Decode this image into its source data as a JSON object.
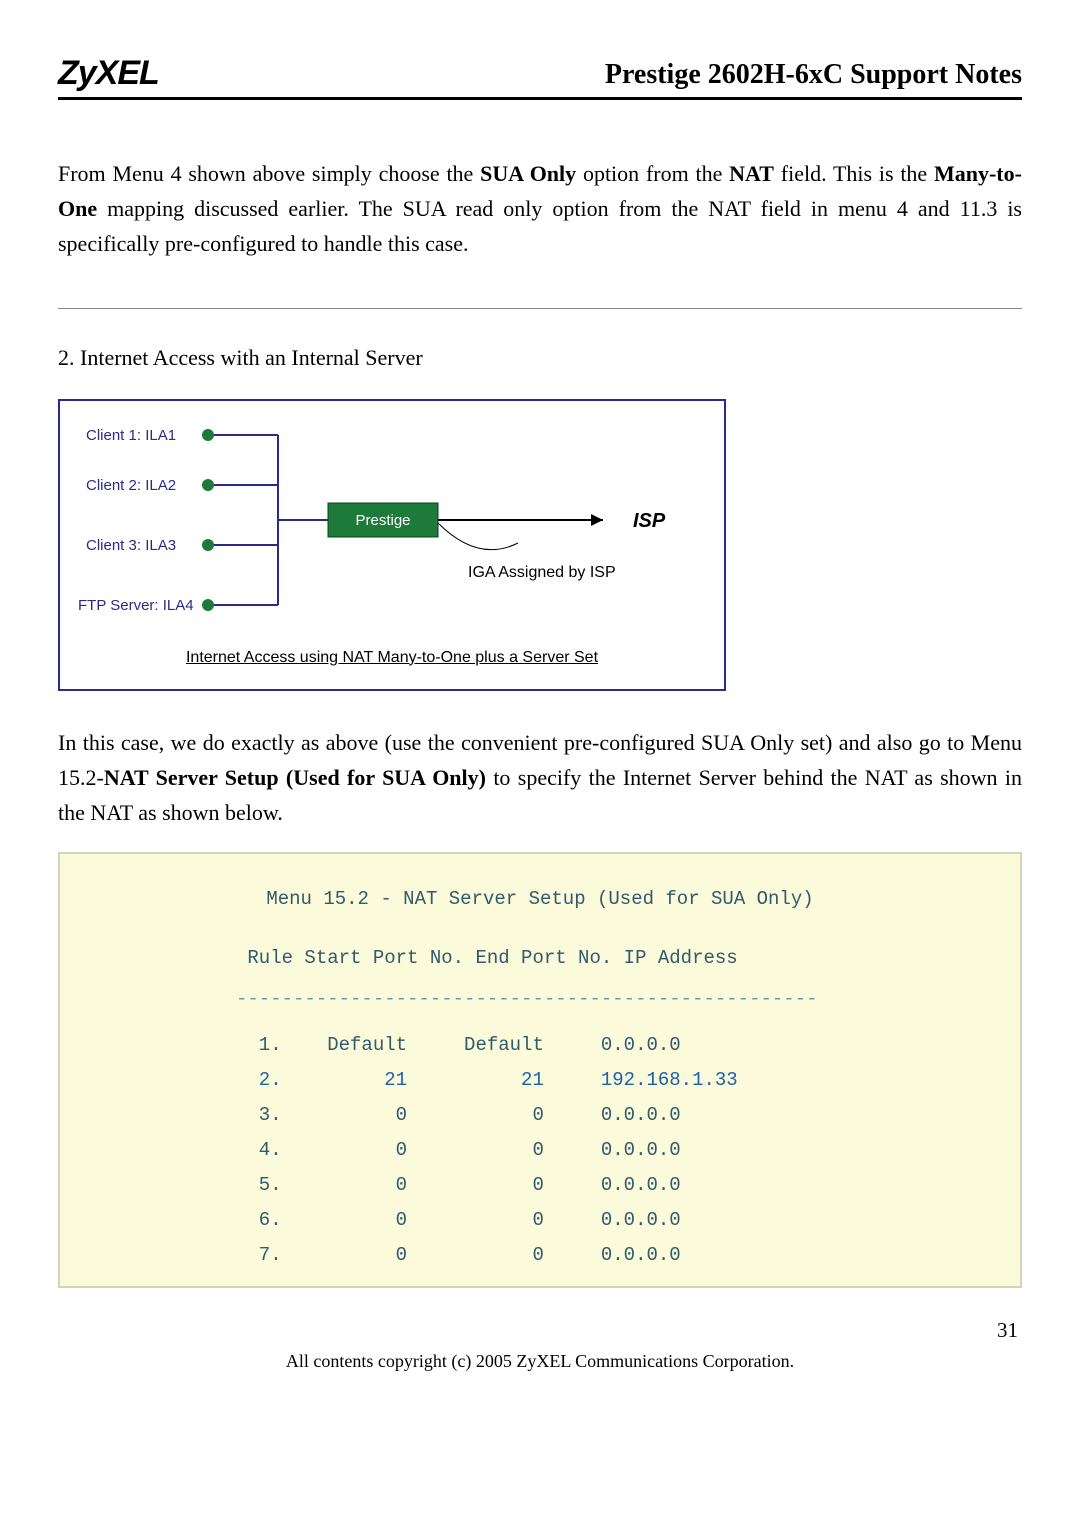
{
  "header": {
    "logo": "ZyXEL",
    "title": "Prestige 2602H-6xC Support Notes"
  },
  "para1_pre": "From Menu 4 shown above simply choose the ",
  "para1_b1": "SUA Only",
  "para1_mid1": " option from the ",
  "para1_b2": "NAT",
  "para1_mid2": " field. This is the ",
  "para1_b3": "Many-to-One",
  "para1_post": " mapping discussed earlier. The SUA read only option from the NAT field in menu 4 and 11.3 is specifically pre-configured to handle this case.",
  "section2_title": "2. Internet Access with an Internal Server",
  "diagram": {
    "client1": "Client 1: ILA1",
    "client2": "Client 2: ILA2",
    "client3": "Client 3: ILA3",
    "ftp": "FTP Server: ILA4",
    "router": "Prestige",
    "isp": "ISP",
    "iga": "IGA Assigned by ISP",
    "caption": "Internet Access using NAT Many-to-One plus a Server Set"
  },
  "para2_pre": "In this case, we do exactly as above (use the convenient pre-configured SUA Only set) and also go to Menu 15.2-",
  "para2_b1": "NAT Server Setup (Used for SUA Only)",
  "para2_post": " to specify the Internet Server behind the NAT as shown in the NAT as shown below.",
  "terminal": {
    "title": "Menu 15.2 - NAT Server Setup (Used for SUA Only)",
    "columns": " Rule Start Port No. End Port No. IP Address",
    "rule": "---------------------------------------------------",
    "rows": [
      {
        "n": "1.",
        "s": "Default",
        "e": "Default",
        "ip": "0.0.0.0",
        "hl": false
      },
      {
        "n": "2.",
        "s": "21",
        "e": "21",
        "ip": "192.168.1.33",
        "hl": true
      },
      {
        "n": "3.",
        "s": "0",
        "e": "0",
        "ip": "0.0.0.0",
        "hl": false
      },
      {
        "n": "4.",
        "s": "0",
        "e": "0",
        "ip": "0.0.0.0",
        "hl": false
      },
      {
        "n": "5.",
        "s": "0",
        "e": "0",
        "ip": "0.0.0.0",
        "hl": false
      },
      {
        "n": "6.",
        "s": "0",
        "e": "0",
        "ip": "0.0.0.0",
        "hl": false
      },
      {
        "n": "7.",
        "s": "0",
        "e": "0",
        "ip": "0.0.0.0",
        "hl": false
      }
    ]
  },
  "pagenum": "31",
  "copyright": "All contents copyright (c) 2005 ZyXEL Communications Corporation.",
  "chart_data": {
    "type": "table",
    "title": "Menu 15.2 - NAT Server Setup (Used for SUA Only)",
    "columns": [
      "Rule",
      "Start Port No.",
      "End Port No.",
      "IP Address"
    ],
    "rows": [
      [
        "1.",
        "Default",
        "Default",
        "0.0.0.0"
      ],
      [
        "2.",
        "21",
        "21",
        "192.168.1.33"
      ],
      [
        "3.",
        "0",
        "0",
        "0.0.0.0"
      ],
      [
        "4.",
        "0",
        "0",
        "0.0.0.0"
      ],
      [
        "5.",
        "0",
        "0",
        "0.0.0.0"
      ],
      [
        "6.",
        "0",
        "0",
        "0.0.0.0"
      ],
      [
        "7.",
        "0",
        "0",
        "0.0.0.0"
      ]
    ]
  }
}
